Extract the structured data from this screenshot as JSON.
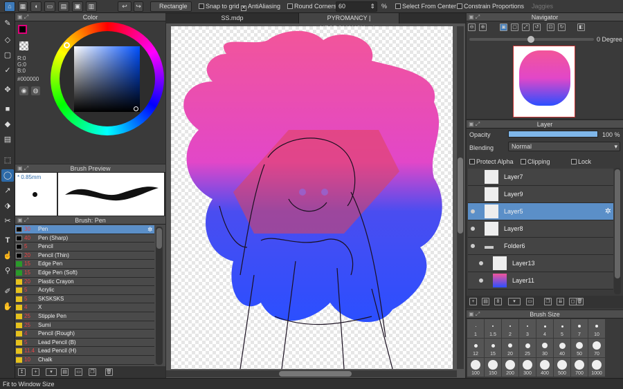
{
  "toolbar": {
    "selection_shape": "Rectangle",
    "snap_to_grid": "Snap to grid",
    "antialiasing": "AntiAliasing",
    "round_corners": "Round Corners",
    "round_value": "60",
    "percent": "%",
    "select_from_center": "Select From Center",
    "constrain_proportions": "Constrain Proportions",
    "jaggies": "Jaggies"
  },
  "color_panel": {
    "title": "Color",
    "r": "R:0",
    "g": "G:0",
    "b": "B:0",
    "hex": "#000000",
    "fg": "#000000",
    "accent": "#e0007a"
  },
  "brush_preview": {
    "title": "Brush Preview",
    "size": "* 0.85mm"
  },
  "brush_list": {
    "title": "Brush: Pen",
    "items": [
      {
        "size": "30",
        "name": "Pen",
        "color": "#000000"
      },
      {
        "size": "40",
        "name": "Pen (Sharp)",
        "color": "#000000"
      },
      {
        "size": "5",
        "name": "Pencil",
        "color": "#000000"
      },
      {
        "size": "20",
        "name": "Pencil (Thin)",
        "color": "#000000"
      },
      {
        "size": "15",
        "name": "Edge Pen",
        "color": "#2a9a2a"
      },
      {
        "size": "15",
        "name": "Edge Pen (Soft)",
        "color": "#2a9a2a"
      },
      {
        "size": "20",
        "name": "Plastic Crayon",
        "color": "#e6c21d"
      },
      {
        "size": "5",
        "name": "Acrylic",
        "color": "#e6c21d"
      },
      {
        "size": "5",
        "name": "SKSKSKS",
        "color": "#e6c21d"
      },
      {
        "size": "4",
        "name": "X",
        "color": "#e6c21d"
      },
      {
        "size": "25",
        "name": "Stipple Pen",
        "color": "#e6c21d"
      },
      {
        "size": "25",
        "name": "Sumi",
        "color": "#e6c21d"
      },
      {
        "size": "4",
        "name": "Pencil (Rough)",
        "color": "#e6c21d"
      },
      {
        "size": "5",
        "name": "Lead Pencil (B)",
        "color": "#e6c21d"
      },
      {
        "size": "11.4",
        "name": "Lead Pencil (H)",
        "color": "#e6c21d"
      },
      {
        "size": "10",
        "name": "Chalk",
        "color": "#e6c21d"
      }
    ]
  },
  "tabs": [
    {
      "label": "SS.mdp"
    },
    {
      "label": "PYROMANCY | NECROMANCY.mdp"
    }
  ],
  "navigator": {
    "title": "Navigator",
    "angle": "0 Degree"
  },
  "layer_panel": {
    "title": "Layer",
    "opacity_label": "Opacity",
    "opacity_value": "100 %",
    "opacity": 1.0,
    "blending_label": "Blending",
    "blending_value": "Normal",
    "protect_alpha": "Protect Alpha",
    "clipping": "Clipping",
    "lock": "Lock",
    "layers": [
      {
        "name": "Layer7"
      },
      {
        "name": "Layer9"
      },
      {
        "name": "Layer5"
      },
      {
        "name": "Layer8"
      },
      {
        "name": "Folder6"
      },
      {
        "name": "Layer13"
      },
      {
        "name": "Layer11"
      }
    ]
  },
  "brush_size": {
    "title": "Brush Size",
    "sizes": [
      "1",
      "1.5",
      "2",
      "3",
      "4",
      "5",
      "7",
      "10",
      "12",
      "15",
      "20",
      "25",
      "30",
      "40",
      "50",
      "70",
      "100",
      "150",
      "200",
      "300",
      "400",
      "500",
      "700",
      "1000"
    ]
  },
  "status": {
    "text": "Fit to Window Size"
  }
}
